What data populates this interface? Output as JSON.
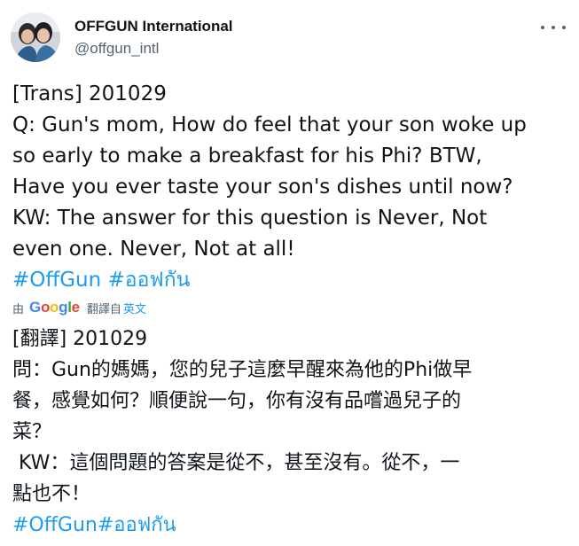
{
  "account": {
    "display_name": "OFFGUN International",
    "handle": "@offgun_intl"
  },
  "tweet": {
    "lines": [
      "[Trans] 201029",
      "Q: Gun's mom, How do feel that your son woke up",
      "so early to make a breakfast for his Phi? BTW,",
      "Have you ever taste your son's dishes until now?",
      "KW: The answer for this question is Never, Not",
      "even one. Never, Not at all!"
    ],
    "hashtags": [
      "#OffGun",
      "#ออฟกัน"
    ]
  },
  "translation": {
    "by_label": "由",
    "provider": "Google",
    "translated_from_label": "翻譯自",
    "language": "英文",
    "lines": [
      "[翻譯] 201029",
      "問：Gun的媽媽，您的兒子這麼早醒來為他的Phi做早",
      "餐，感覺如何？順便說一句，你有沒有品嚐過兒子的",
      "菜？",
      " KW：這個問題的答案是從不，甚至沒有。從不，一",
      "點也不！"
    ],
    "hashtags": "#OffGun#ออฟกัน"
  },
  "colors": {
    "text": "#0f1419",
    "secondary": "#536471",
    "link": "#1d9bf0"
  },
  "icons": {
    "more": "more-horizontal-icon",
    "avatar": "profile-photo"
  }
}
